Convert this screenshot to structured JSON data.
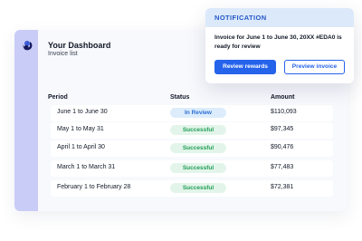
{
  "dashboard": {
    "title": "Your Dashboard",
    "subtitle": "Invoice list",
    "logo_icon": "logo-icon",
    "columns": {
      "period": "Period",
      "status": "Status",
      "amount": "Amount"
    },
    "rows": [
      {
        "period": "June 1 to June 30",
        "status": "In Review",
        "status_kind": "review",
        "amount": "$110,093"
      },
      {
        "period": "May 1 to May 31",
        "status": "Successful",
        "status_kind": "success",
        "amount": "$97,345"
      },
      {
        "period": "April 1 to April 30",
        "status": "Successful",
        "status_kind": "success",
        "amount": "$90,476"
      },
      {
        "period": "March 1 to March 31",
        "status": "Successful",
        "status_kind": "success",
        "amount": "$77,483"
      },
      {
        "period": "February 1 to February 28",
        "status": "Successful",
        "status_kind": "success",
        "amount": "$72,381"
      }
    ]
  },
  "notification": {
    "heading": "NOTIFICATION",
    "message": "Invoice for June 1 to June 30, 20XX #EDA0 is ready for review",
    "primary_button": "Review rewards",
    "secondary_button": "Preview invoice"
  },
  "colors": {
    "accent": "#2563eb",
    "sidebar": "#c9ccf6",
    "notification_header": "#dbe9fb",
    "review_badge_bg": "#dcecfb",
    "review_badge_text": "#2b6fd6",
    "success_badge_bg": "#e3f5ea",
    "success_badge_text": "#1f9d55"
  }
}
